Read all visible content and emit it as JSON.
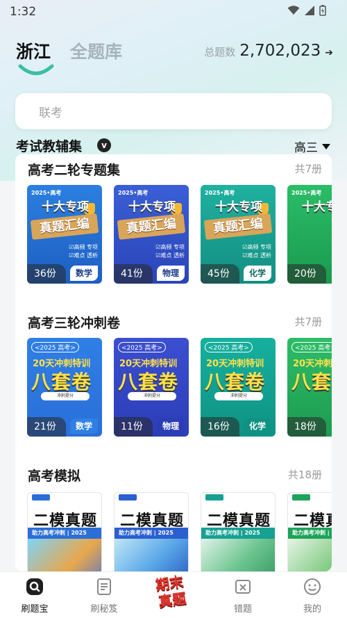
{
  "status": {
    "time": "1:32"
  },
  "header": {
    "tabs": [
      {
        "label": "浙江"
      },
      {
        "label": "全题库"
      }
    ],
    "total_label": "总题数",
    "total_value": "2,702,023"
  },
  "search": {
    "placeholder": "联考"
  },
  "section": {
    "title": "考试教辅集",
    "badge": "v",
    "grade": "高三"
  },
  "shelves": [
    {
      "title": "高考二轮专题集",
      "count": "共7册",
      "books": [
        {
          "count": "36份",
          "subject": "数学",
          "color": "#1f5fc4"
        },
        {
          "count": "41份",
          "subject": "物理",
          "color": "#2d53c9"
        },
        {
          "count": "45份",
          "subject": "化学",
          "color": "#169c8f"
        },
        {
          "count": "20份",
          "subject": "",
          "color": "#1ea35a"
        }
      ]
    },
    {
      "title": "高考三轮冲刺卷",
      "count": "共7册",
      "books": [
        {
          "count": "21份",
          "subject": "数学",
          "color": "#2a7be3"
        },
        {
          "count": "11份",
          "subject": "物理",
          "color": "#2f47c4"
        },
        {
          "count": "16份",
          "subject": "化学",
          "color": "#12a292"
        },
        {
          "count": "18份",
          "subject": "",
          "color": "#1fa85b"
        }
      ]
    },
    {
      "title": "高考模拟",
      "count": "共18册",
      "books": [
        {
          "count": "",
          "subject": "",
          "color": "#2b6fd6"
        },
        {
          "count": "",
          "subject": "",
          "color": "#2a5fd0"
        },
        {
          "count": "",
          "subject": "",
          "color": "#16a193"
        },
        {
          "count": "",
          "subject": "",
          "color": "#1ea35a"
        }
      ]
    }
  ],
  "cover_text": {
    "review_year": "2025•高考",
    "review_big1": "十大专项",
    "review_big2": "真题汇编",
    "review_lines": "☑高频 专项\n☑难点 透析",
    "sprint_top": "<2025 高考>",
    "sprint_mid": "20天冲刺特训",
    "sprint_big": "八套卷",
    "sprint_tag": "冲刺提分",
    "mock_big": "二模真题",
    "mock_band": "助力高考冲刺 | 2025"
  },
  "nav": {
    "items": [
      {
        "label": "刷题宝"
      },
      {
        "label": "刷秘笈"
      },
      {
        "label": "期末真题"
      },
      {
        "label": "错题"
      },
      {
        "label": "我的"
      }
    ]
  }
}
